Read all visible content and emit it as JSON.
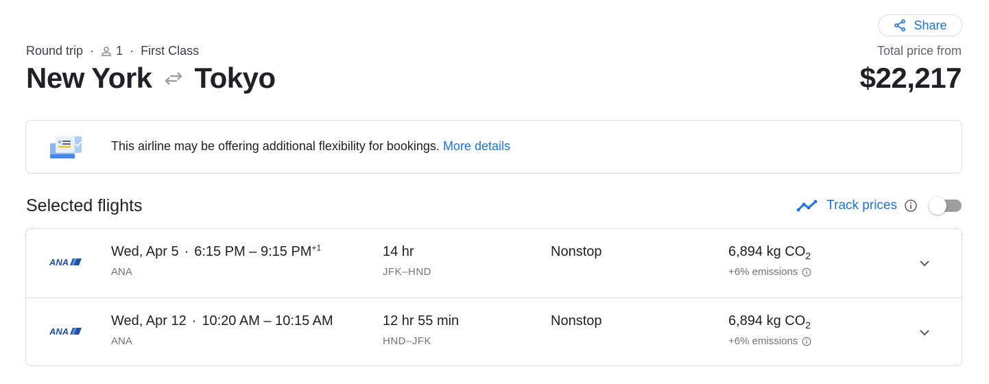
{
  "header": {
    "share_label": "Share",
    "trip_type": "Round trip",
    "passengers": "1",
    "cabin_class": "First Class",
    "origin": "New York",
    "destination": "Tokyo",
    "price_label": "Total price from",
    "price": "$22,217"
  },
  "notice": {
    "text": "This airline may be offering additional flexibility for bookings.",
    "link_label": "More details"
  },
  "selected": {
    "title": "Selected flights",
    "track_label": "Track prices",
    "track_enabled": false
  },
  "flights": [
    {
      "airline_logo": "ANA",
      "date": "Wed, Apr 5",
      "depart": "6:15 PM",
      "arrive": "9:15 PM",
      "day_offset": "+1",
      "airline": "ANA",
      "duration": "14 hr",
      "airports": "JFK–HND",
      "stops": "Nonstop",
      "co2_value": "6,894 kg CO",
      "co2_sub": "2",
      "emissions": "+6% emissions"
    },
    {
      "airline_logo": "ANA",
      "date": "Wed, Apr 12",
      "depart": "10:20 AM",
      "arrive": "10:15 AM",
      "day_offset": "",
      "airline": "ANA",
      "duration": "12 hr 55 min",
      "airports": "HND–JFK",
      "stops": "Nonstop",
      "co2_value": "6,894 kg CO",
      "co2_sub": "2",
      "emissions": "+6% emissions"
    }
  ],
  "colors": {
    "accent": "#1a73e8",
    "text_primary": "#202124",
    "text_secondary": "#70757a",
    "border": "#dadce0",
    "ana_blue": "#1f4ea3"
  }
}
